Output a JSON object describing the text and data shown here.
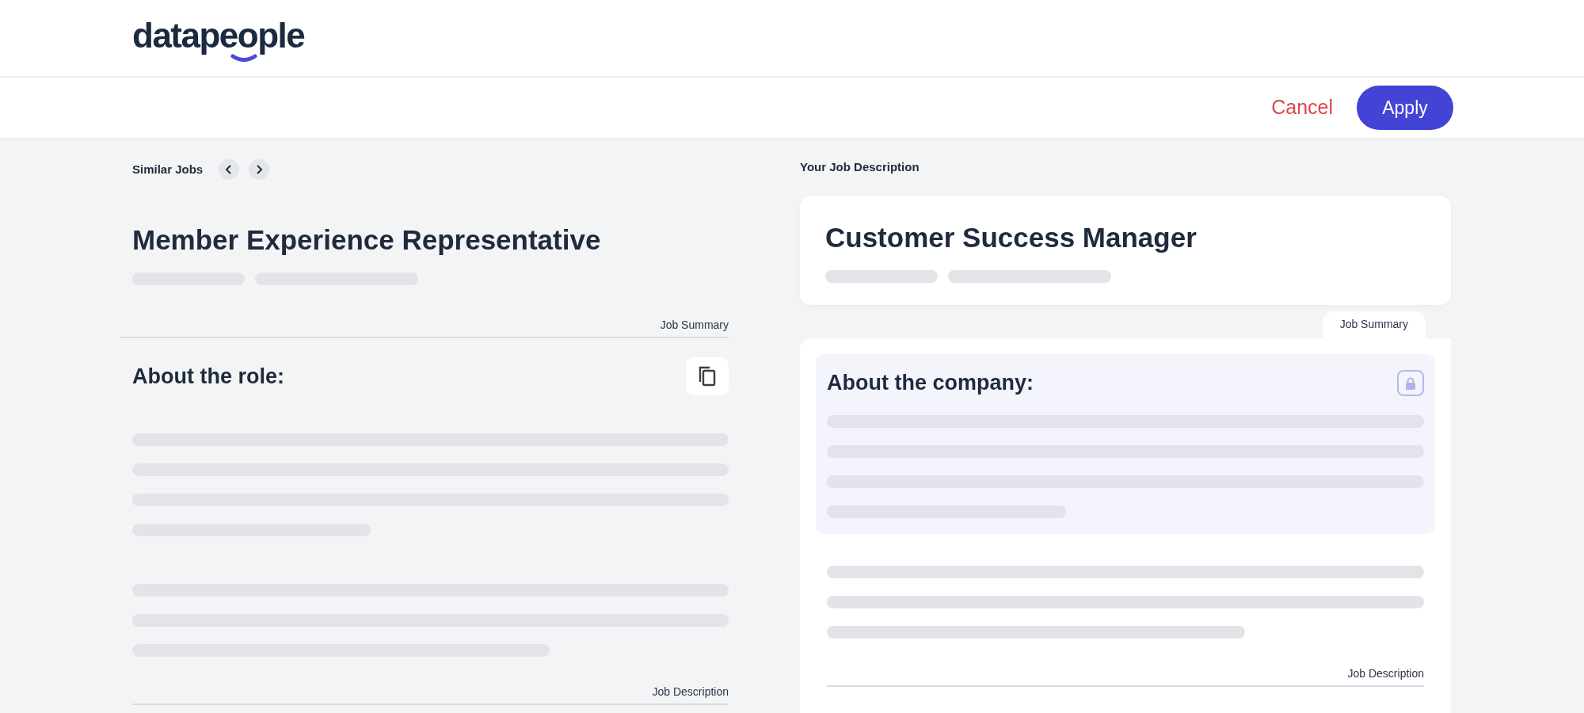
{
  "logo": {
    "text": "datapeople"
  },
  "toolbar": {
    "buttons": [
      {
        "label": "Cancel",
        "kind": "link"
      },
      {
        "label": "Apply",
        "kind": "primary"
      }
    ]
  },
  "similar": {
    "label": "Similar Jobs",
    "title": "Member Experience Representative",
    "summary_label": "Job Summary",
    "section_heading": "About the role:",
    "description_label": "Job Description"
  },
  "yours": {
    "label": "Your Job Description",
    "title": "Customer Success Manager",
    "summary_label": "Job Summary",
    "section_heading": "About the company:",
    "description_label": "Job Description"
  }
}
